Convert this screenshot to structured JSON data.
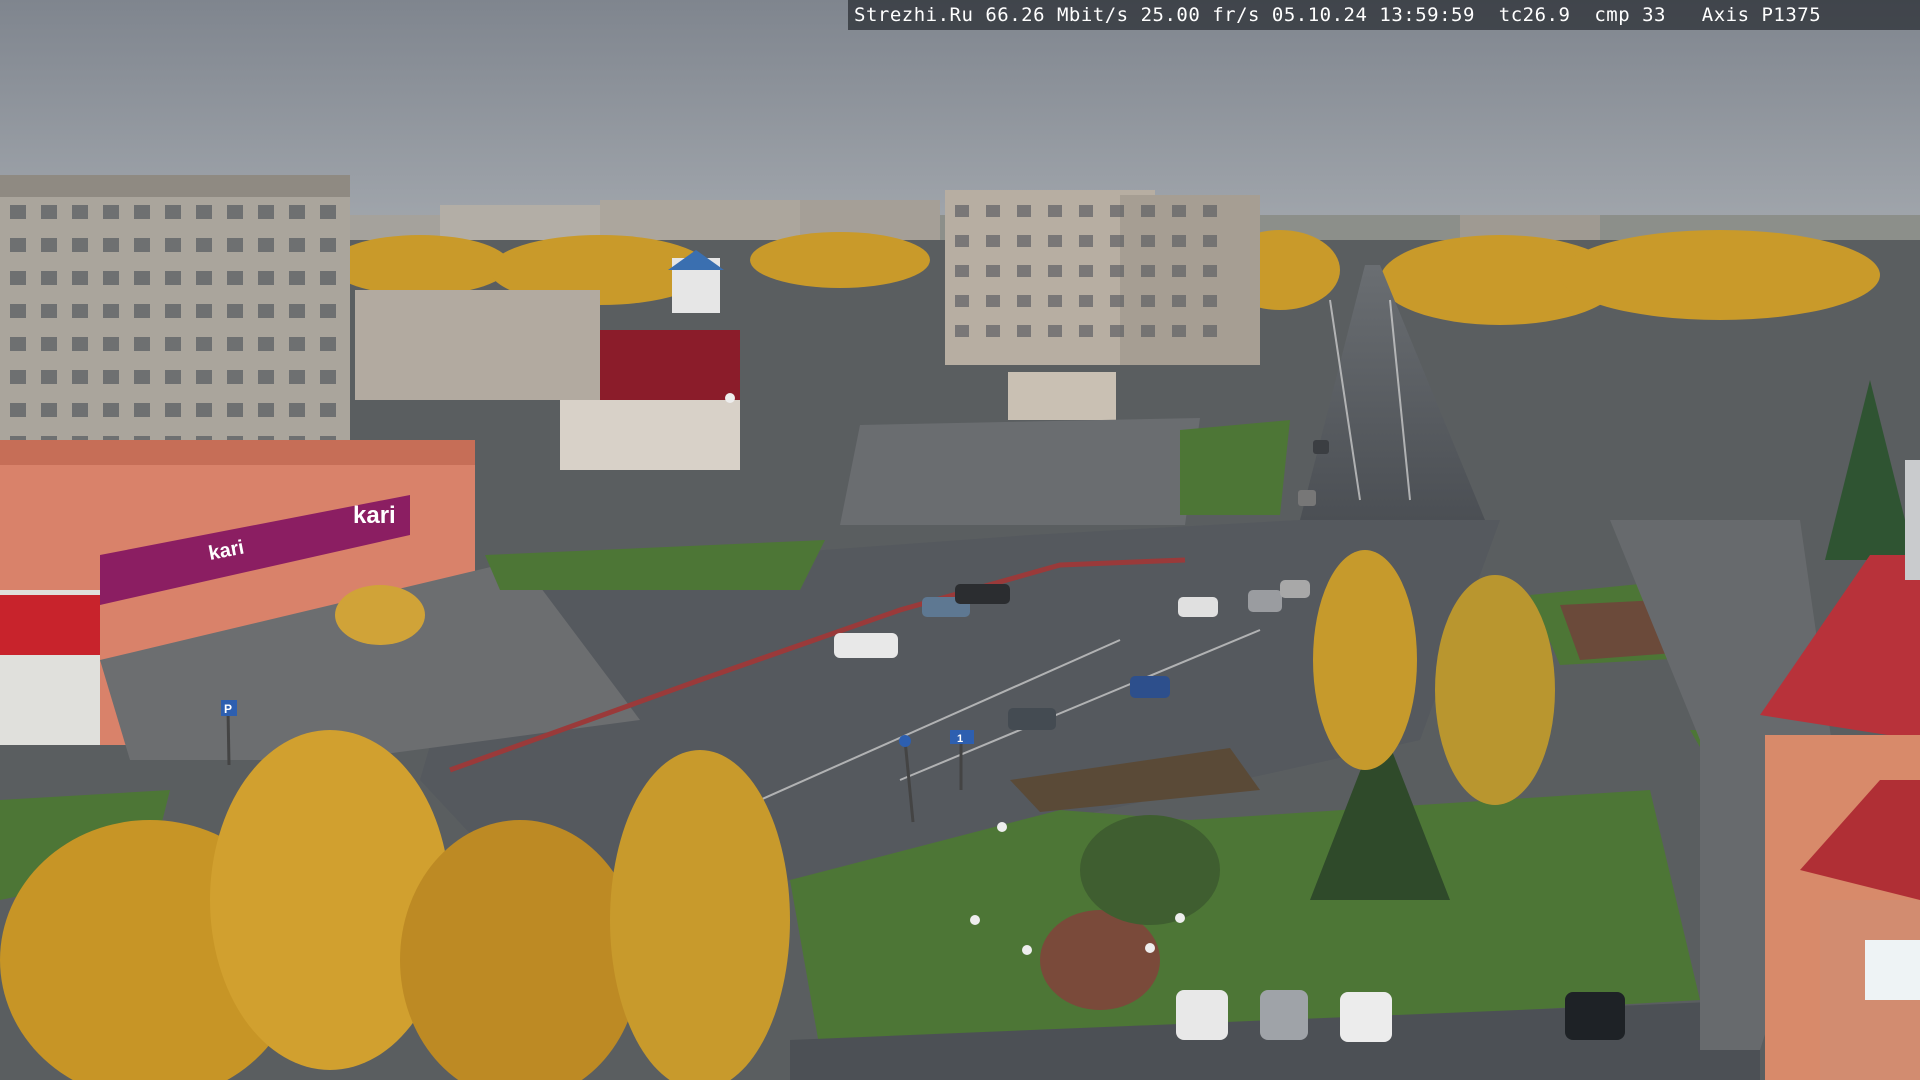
{
  "osd": {
    "site": "Strezhi.Ru",
    "bitrate": "66.26 Mbit/s",
    "framerate": "25.00 fr/s",
    "date": "05.10.24",
    "time": "13:59:59",
    "tc": "tc26.9",
    "cmp": "cmp 33",
    "camera": "Axis P1375"
  },
  "signs": {
    "store_logo": "kari",
    "store_banner": "kari",
    "parking_sign": "P",
    "road_sign": "1"
  },
  "palette": {
    "sky": "#8e949c",
    "foliage": "#d9a82a",
    "asphalt": "#55595e",
    "grass": "#4f7a35",
    "store_magenta": "#8b1e62"
  }
}
